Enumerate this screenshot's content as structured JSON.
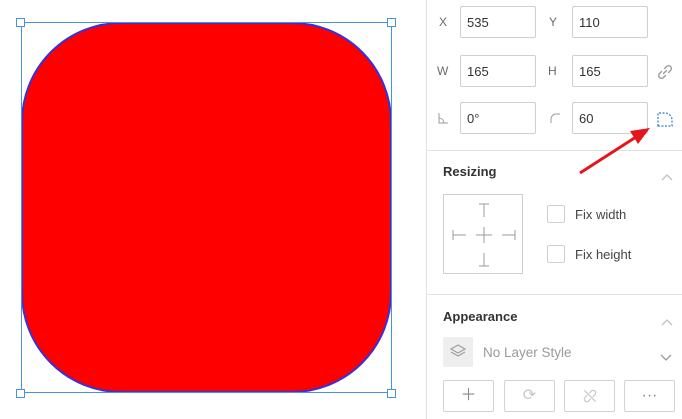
{
  "canvas": {
    "shape_fill": "#ff0000",
    "shape_stroke": "#3a2fd8",
    "selection_color": "#4a90e2"
  },
  "inspector": {
    "position": {
      "x_label": "X",
      "x_value": "535",
      "y_label": "Y",
      "y_value": "110"
    },
    "size": {
      "w_label": "W",
      "w_value": "165",
      "h_label": "H",
      "h_value": "165",
      "lock_icon": "link-icon"
    },
    "transform": {
      "rotation_icon": "angle-icon",
      "rotation_value": "0°",
      "radius_icon": "corner-radius-icon",
      "radius_value": "60",
      "independent_corners_icon": "independent-corners-icon"
    },
    "resizing": {
      "title": "Resizing",
      "fix_width_label": "Fix width",
      "fix_height_label": "Fix height"
    },
    "appearance": {
      "title": "Appearance",
      "layer_style_placeholder": "No Layer Style",
      "buttons": [
        "add-style-icon",
        "sync-style-icon",
        "detach-style-icon",
        "more-icon"
      ]
    }
  },
  "annotation": {
    "arrow_color": "#e3161b"
  }
}
